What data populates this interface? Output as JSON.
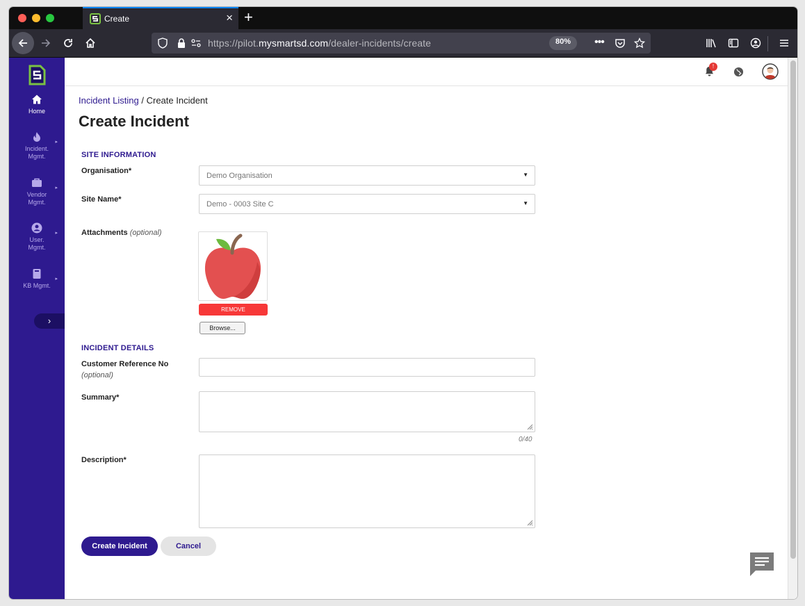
{
  "browser": {
    "tab_title": "Create",
    "url_prefix": "https://pilot.",
    "url_domain": "mysmartsd.com",
    "url_path": "/dealer-incidents/create",
    "zoom": "80%"
  },
  "sidebar": {
    "items": [
      {
        "label": "Home",
        "active": true
      },
      {
        "label": "Incident. Mgmt."
      },
      {
        "label": "Vendor Mgmt."
      },
      {
        "label": "User. Mgmt."
      },
      {
        "label": "KB Mgmt."
      }
    ]
  },
  "header": {
    "notification_badge": "!"
  },
  "breadcrumb": {
    "link": "Incident Listing",
    "separator": "/",
    "current": "Create Incident"
  },
  "page_title": "Create Incident",
  "site_section": {
    "title": "SITE INFORMATION",
    "organisation_label": "Organisation*",
    "organisation_value": "Demo Organisation",
    "site_label": "Site Name*",
    "site_value": "Demo - 0003 Site C",
    "attachments_label": "Attachments",
    "attachments_optional": "(optional)",
    "remove_label": "REMOVE",
    "browse_label": "Browse..."
  },
  "incident_section": {
    "title": "INCIDENT DETAILS",
    "customer_ref_label": "Customer Reference No",
    "customer_ref_optional": "(optional)",
    "customer_ref_value": "",
    "summary_label": "Summary*",
    "summary_value": "",
    "summary_counter": "0/40",
    "description_label": "Description*",
    "description_value": ""
  },
  "actions": {
    "create_label": "Create Incident",
    "cancel_label": "Cancel"
  },
  "colors": {
    "brand": "#2e1a8f",
    "danger": "#f73838",
    "badge": "#e53935"
  }
}
